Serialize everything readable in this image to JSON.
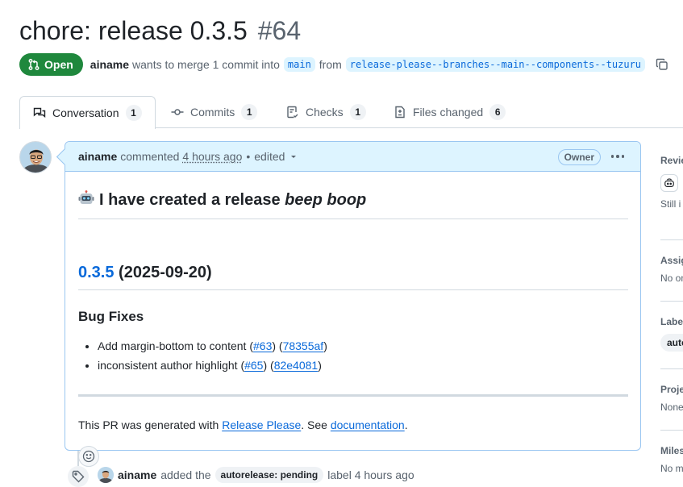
{
  "pr": {
    "title": "chore: release 0.3.5",
    "number": "#64",
    "state": "Open",
    "author": "ainame",
    "merge_text_1": "wants to merge 1 commit into",
    "base_branch": "main",
    "from_text": "from",
    "head_branch": "release-please--branches--main--components--tuzuru"
  },
  "tabs": [
    {
      "label": "Conversation",
      "count": "1"
    },
    {
      "label": "Commits",
      "count": "1"
    },
    {
      "label": "Checks",
      "count": "1"
    },
    {
      "label": "Files changed",
      "count": "6"
    }
  ],
  "comment": {
    "author": "ainame",
    "action": "commented",
    "time": "4 hours ago",
    "edited": "edited",
    "badge": "Owner",
    "heading_plain": "I have created a release",
    "heading_italic": "beep boop",
    "version_link": "0.3.5",
    "version_date": "(2025-09-20)",
    "section": "Bug Fixes",
    "items": [
      {
        "text": "Add margin-bottom to content (",
        "pr": "#63",
        "mid": ") (",
        "sha": "78355af",
        "end": ")"
      },
      {
        "text": "inconsistent author highlight (",
        "pr": "#65",
        "mid": ") (",
        "sha": "82e4081",
        "end": ")"
      }
    ],
    "footer_1": "This PR was generated with",
    "footer_link_1": "Release Please",
    "footer_2": ". See",
    "footer_link_2": "documentation",
    "footer_3": "."
  },
  "timeline": {
    "author": "ainame",
    "text": "added the",
    "label": "autorelease: pending",
    "suffix": "label 4 hours ago"
  },
  "sidebar": {
    "reviewers": "Revie",
    "reviewers_text": "Still i",
    "assignees": "Assig",
    "assignees_text": "No on",
    "labels": "Labe",
    "labels_pill": "auto",
    "projects": "Proje",
    "projects_text": "None",
    "milestone": "Miles",
    "milestone_text": "No m"
  },
  "colors": {
    "open_green": "#1f883d",
    "link_blue": "#0969da",
    "header_blue": "#ddf4ff"
  }
}
